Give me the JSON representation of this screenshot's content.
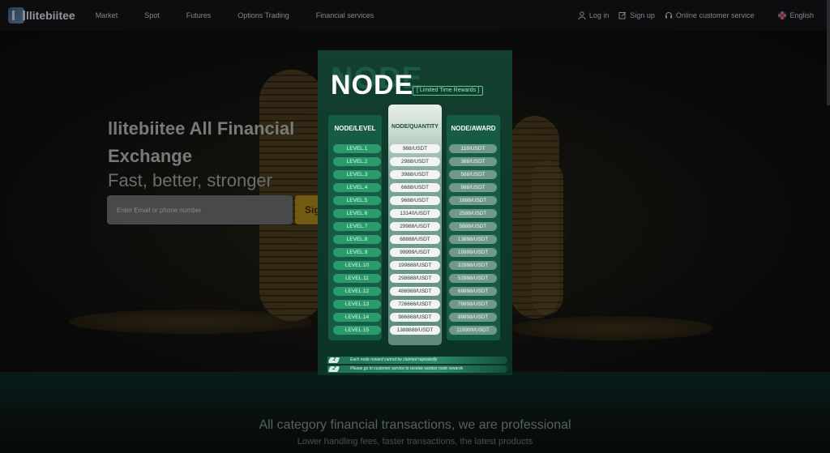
{
  "nav": {
    "brand": "llitebiitee",
    "menu": [
      "Market",
      "Spot",
      "Futures",
      "Options Trading",
      "Financial services"
    ],
    "login": "Log in",
    "signup": "Sign up",
    "support": "Online customer service",
    "language": "English"
  },
  "hero": {
    "title": "llitebiitee All Financial Exchange",
    "subtitle": "Fast, better, stronger",
    "email_placeholder": "Enter Email or phone number",
    "signup_button": "Sig"
  },
  "popup": {
    "shadow_title": "NODE",
    "title": "NODE",
    "tag": "[ Limited Time Rewards ]",
    "headers": {
      "level": "NODE/LEVEL",
      "quantity": "NODE/QUANTITY",
      "award": "NODE/AWARD"
    },
    "rows": [
      {
        "level": "LEVEL.1",
        "quantity": "988/USDT",
        "award": "118/USDT"
      },
      {
        "level": "LEVEL.2",
        "quantity": "2988/USDT",
        "award": "388/USDT"
      },
      {
        "level": "LEVEL.3",
        "quantity": "3988/USDT",
        "award": "588/USDT"
      },
      {
        "level": "LEVEL.4",
        "quantity": "6688/USDT",
        "award": "988/USDT"
      },
      {
        "level": "LEVEL.5",
        "quantity": "9688/USDT",
        "award": "1888/USDT"
      },
      {
        "level": "LEVEL.6",
        "quantity": "13140/USDT",
        "award": "2588/USDT"
      },
      {
        "level": "LEVEL.7",
        "quantity": "29988/USDT",
        "award": "5888/USDT"
      },
      {
        "level": "LEVEL.8",
        "quantity": "68888/USDT",
        "award": "13888/USDT"
      },
      {
        "level": "LEVEL.9",
        "quantity": "99999/USDT",
        "award": "19999/USDT"
      },
      {
        "level": "LEVEL.10",
        "quantity": "199888/USDT",
        "award": "32888/USDT"
      },
      {
        "level": "LEVEL.11",
        "quantity": "298888/USDT",
        "award": "52888/USDT"
      },
      {
        "level": "LEVEL.12",
        "quantity": "486988/USDT",
        "award": "68888/USDT"
      },
      {
        "level": "LEVEL.13",
        "quantity": "726666/USDT",
        "award": "79898/USDT"
      },
      {
        "level": "LEVEL.14",
        "quantity": "986868/USDT",
        "award": "89898/USDT"
      },
      {
        "level": "LEVEL.15",
        "quantity": "1388888/USDT",
        "award": "119999/USDT"
      }
    ],
    "notes": [
      {
        "num": "1",
        "text": "Each node reward cannot be claimed repeatedly"
      },
      {
        "num": "2",
        "text": "Please go to customer service to receive various node rewards"
      }
    ]
  },
  "lower": {
    "title": "All category financial transactions, we are professional",
    "subtitle": "Lower handling fees, faster transactions, the latest products"
  },
  "colors": {
    "accent_gold": "#b08a1c",
    "popup_green": "#14402f",
    "level_pill": "#2c9b6c"
  }
}
